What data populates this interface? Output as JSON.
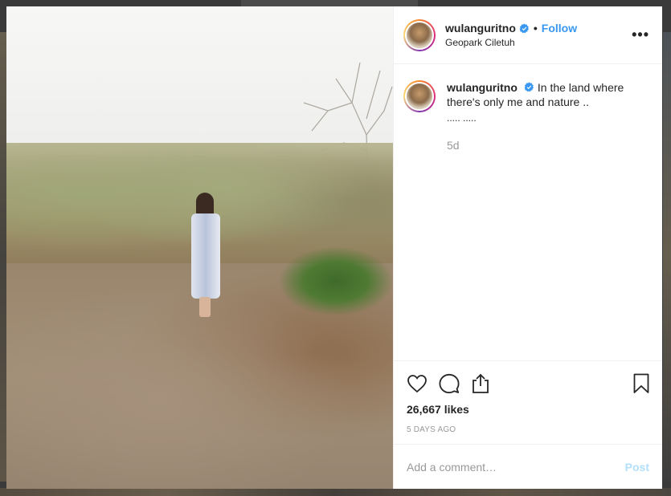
{
  "post": {
    "username": "wulanguritno",
    "verified": true,
    "follow_label": "Follow",
    "separator": "•",
    "location": "Geopark Ciletuh",
    "more_label": "•••"
  },
  "caption": {
    "username": "wulanguritno",
    "text": "In the land where there's only me and nature ..",
    "dots": "..... .....",
    "time": "5d"
  },
  "stats": {
    "likes": "26,667 likes",
    "posted_ago": "5 DAYS AGO"
  },
  "comment_box": {
    "placeholder": "Add a comment…",
    "post_label": "Post"
  },
  "icons": {
    "like": "heart-icon",
    "comment": "comment-bubble-icon",
    "share": "share-icon",
    "save": "bookmark-icon",
    "verified": "verified-badge-icon"
  },
  "colors": {
    "link": "#3897f0",
    "post_disabled": "#b2dffc",
    "text": "#262626",
    "muted": "#999999"
  }
}
